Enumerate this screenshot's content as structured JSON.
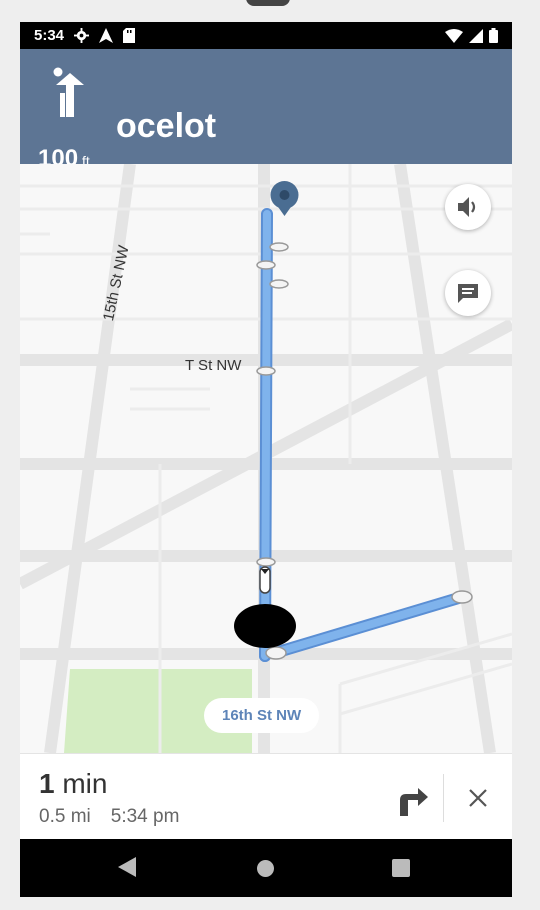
{
  "status_bar": {
    "time": "5:34",
    "icons_left": [
      "settings-gear",
      "navigation-arrow",
      "sd-card"
    ],
    "icons_right": [
      "wifi",
      "cell-signal",
      "battery"
    ]
  },
  "header": {
    "maneuver_icon": "turn-slight-left-arrow",
    "distance_value": "100",
    "distance_unit": "ft",
    "street_name": "ocelot",
    "background_color": "#5d7594"
  },
  "map": {
    "street_labels": {
      "fifteenth": "15th St NW",
      "t_street": "T St NW",
      "sixteenth": "16th St NW"
    },
    "buttons": {
      "volume_icon": "volume-icon",
      "report_icon": "message-icon"
    },
    "route_color": "#7fb3ec",
    "park_color": "#d4edc2"
  },
  "eta": {
    "duration_value": "1",
    "duration_unit": "min",
    "distance": "0.5 mi",
    "arrival_time": "5:34 pm"
  },
  "bottom_icons": {
    "alt_route": "alt-route-icon",
    "close": "close-icon"
  },
  "android_nav": [
    "back",
    "home",
    "recents"
  ]
}
